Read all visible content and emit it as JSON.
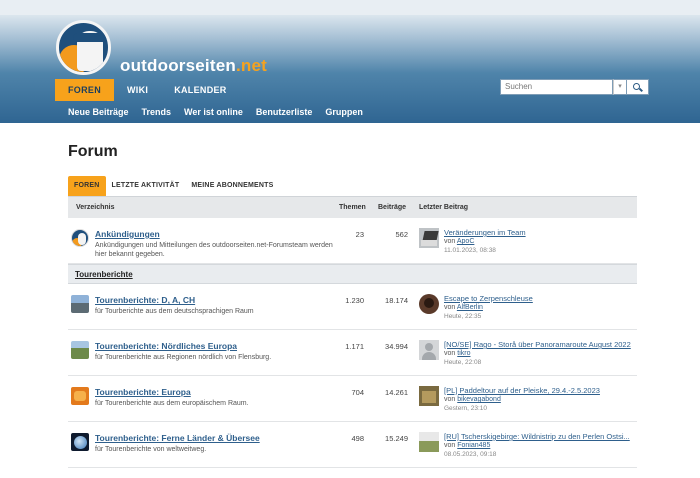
{
  "brand": {
    "name": "outdoorseiten",
    "tld": ".net"
  },
  "mainnav": [
    "FOREN",
    "WIKI",
    "KALENDER"
  ],
  "subnav": [
    "Neue Beiträge",
    "Trends",
    "Wer ist online",
    "Benutzerliste",
    "Gruppen"
  ],
  "search": {
    "placeholder": "Suchen"
  },
  "page": {
    "title": "Forum"
  },
  "tabs": [
    "FOREN",
    "LETZTE AKTIVITÄT",
    "MEINE ABONNEMENTS"
  ],
  "table": {
    "headers": {
      "directory": "Verzeichnis",
      "topics": "Themen",
      "posts": "Beiträge",
      "last": "Letzter Beitrag"
    },
    "announcement": {
      "title": "Ankündigungen",
      "desc": "Ankündigungen und Mitteilungen des outdoorseiten.net-Forumsteam werden hier bekannt gegeben.",
      "topics": "23",
      "posts": "562",
      "last_title": "Veränderungen im Team",
      "last_by": "von",
      "last_user": "ApoC",
      "last_date": "11.01.2023, 08:38"
    },
    "category": "Tourenberichte",
    "forums": [
      {
        "title": "Tourenberichte: D, A, CH",
        "desc": "für Tourberichte aus dem deutschsprachigen Raum",
        "topics": "1.230",
        "posts": "18.174",
        "last_title": "Escape to Zerpenschleuse",
        "last_by": "von",
        "last_user": "AlfBerlin",
        "last_date": "Heute, 22:35"
      },
      {
        "title": "Tourenberichte: Nördliches Europa",
        "desc": "für Tourenberichte aus Regionen nördlich von Flensburg.",
        "topics": "1.171",
        "posts": "34.994",
        "last_title": "[NO/SE] Rago - Storå über Panoramaroute August 2022",
        "last_by": "von",
        "last_user": "tikro",
        "last_date": "Heute, 22:08"
      },
      {
        "title": "Tourenberichte: Europa",
        "desc": "für Tourenberichte aus dem europäischem Raum.",
        "topics": "704",
        "posts": "14.261",
        "last_title": "[PL] Paddeltour auf der Pleiske, 29.4.-2.5.2023",
        "last_by": "von",
        "last_user": "bikevagabond",
        "last_date": "Gestern, 23:10"
      },
      {
        "title": "Tourenberichte: Ferne Länder & Übersee",
        "desc": "für Tourenberichte von weltweitweg.",
        "topics": "498",
        "posts": "15.249",
        "last_title": "[RU] Tscherskigebirge: Wildnistrip zu den Perlen Ostsi...",
        "last_by": "von",
        "last_user": "Fonian485",
        "last_date": "08.05.2023, 09:18"
      }
    ]
  }
}
